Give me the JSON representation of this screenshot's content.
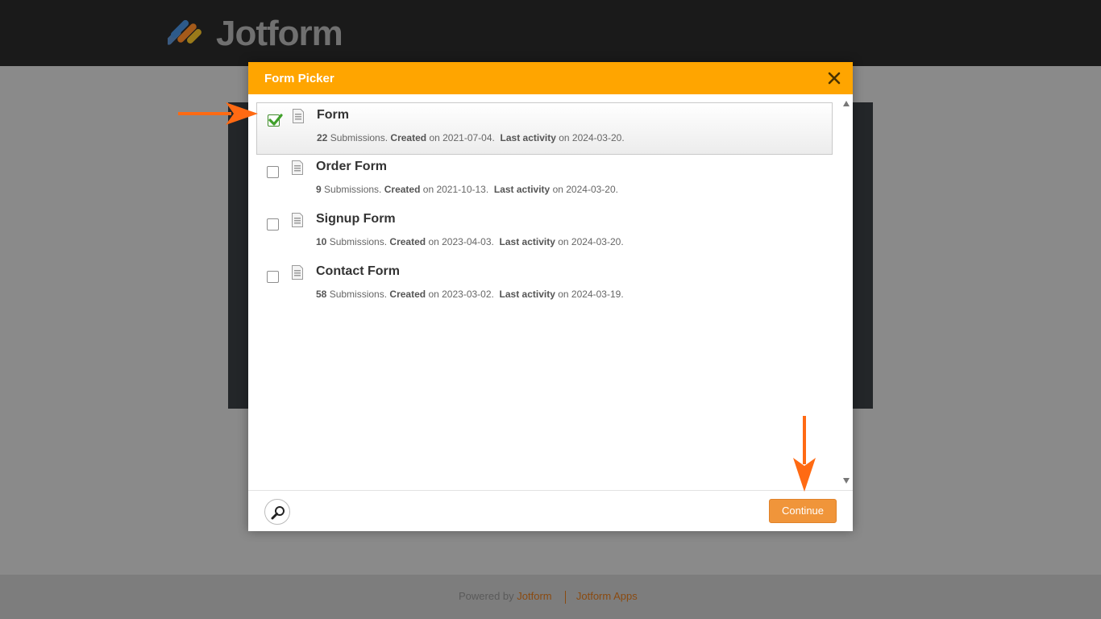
{
  "brand": {
    "name": "Jotform",
    "colors": [
      "#1f6fd1",
      "#f0952a",
      "#e8501f",
      "#f5c11a"
    ]
  },
  "dialog": {
    "title": "Form Picker",
    "close_icon": "close-icon",
    "forms": [
      {
        "title": "Form",
        "submissions": "22",
        "submissions_label": "Submissions.",
        "created_label": "Created",
        "created_on": "on 2021-07-04.",
        "activity_label": "Last activity",
        "activity_on": "on 2024-03-20.",
        "selected": true
      },
      {
        "title": "Order Form",
        "submissions": "9",
        "submissions_label": "Submissions.",
        "created_label": "Created",
        "created_on": "on 2021-10-13.",
        "activity_label": "Last activity",
        "activity_on": "on 2024-03-20.",
        "selected": false
      },
      {
        "title": "Signup Form",
        "submissions": "10",
        "submissions_label": "Submissions.",
        "created_label": "Created",
        "created_on": "on 2023-04-03.",
        "activity_label": "Last activity",
        "activity_on": "on 2024-03-20.",
        "selected": false
      },
      {
        "title": "Contact Form",
        "submissions": "58",
        "submissions_label": "Submissions.",
        "created_label": "Created",
        "created_on": "on 2023-03-02.",
        "activity_label": "Last activity",
        "activity_on": "on 2024-03-19.",
        "selected": false
      }
    ],
    "search_icon": "search-icon",
    "continue_label": "Continue",
    "accent_color": "#ffa500",
    "button_color": "#f0953a"
  },
  "footer": {
    "powered_by": "Powered by",
    "brand": "Jotform",
    "apps": "Jotform Apps"
  }
}
